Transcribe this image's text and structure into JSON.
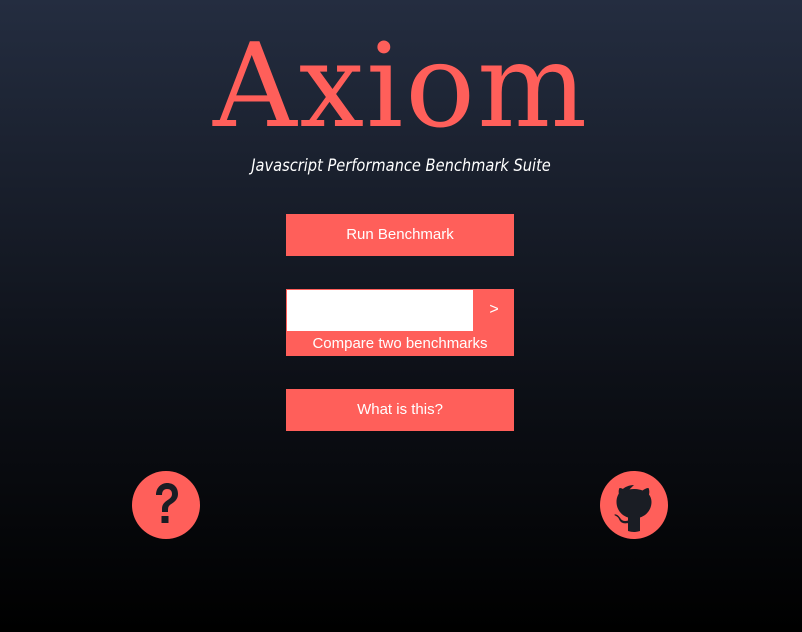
{
  "app": {
    "title": "Axiom",
    "subtitle": "Javascript Performance Benchmark Suite"
  },
  "buttons": {
    "run_label": "Run Benchmark",
    "what_label": "What is this?"
  },
  "compare": {
    "input_value": "",
    "input_placeholder": "",
    "go_label": ">",
    "label": "Compare two benchmarks"
  },
  "icons": {
    "help": "help-question-icon",
    "github": "github-icon"
  },
  "colors": {
    "accent": "#ff5f5a",
    "bg_top": "#242d40",
    "bg_bottom": "#000000",
    "text": "#ffffff",
    "icon_glyph": "#1a1d24"
  }
}
